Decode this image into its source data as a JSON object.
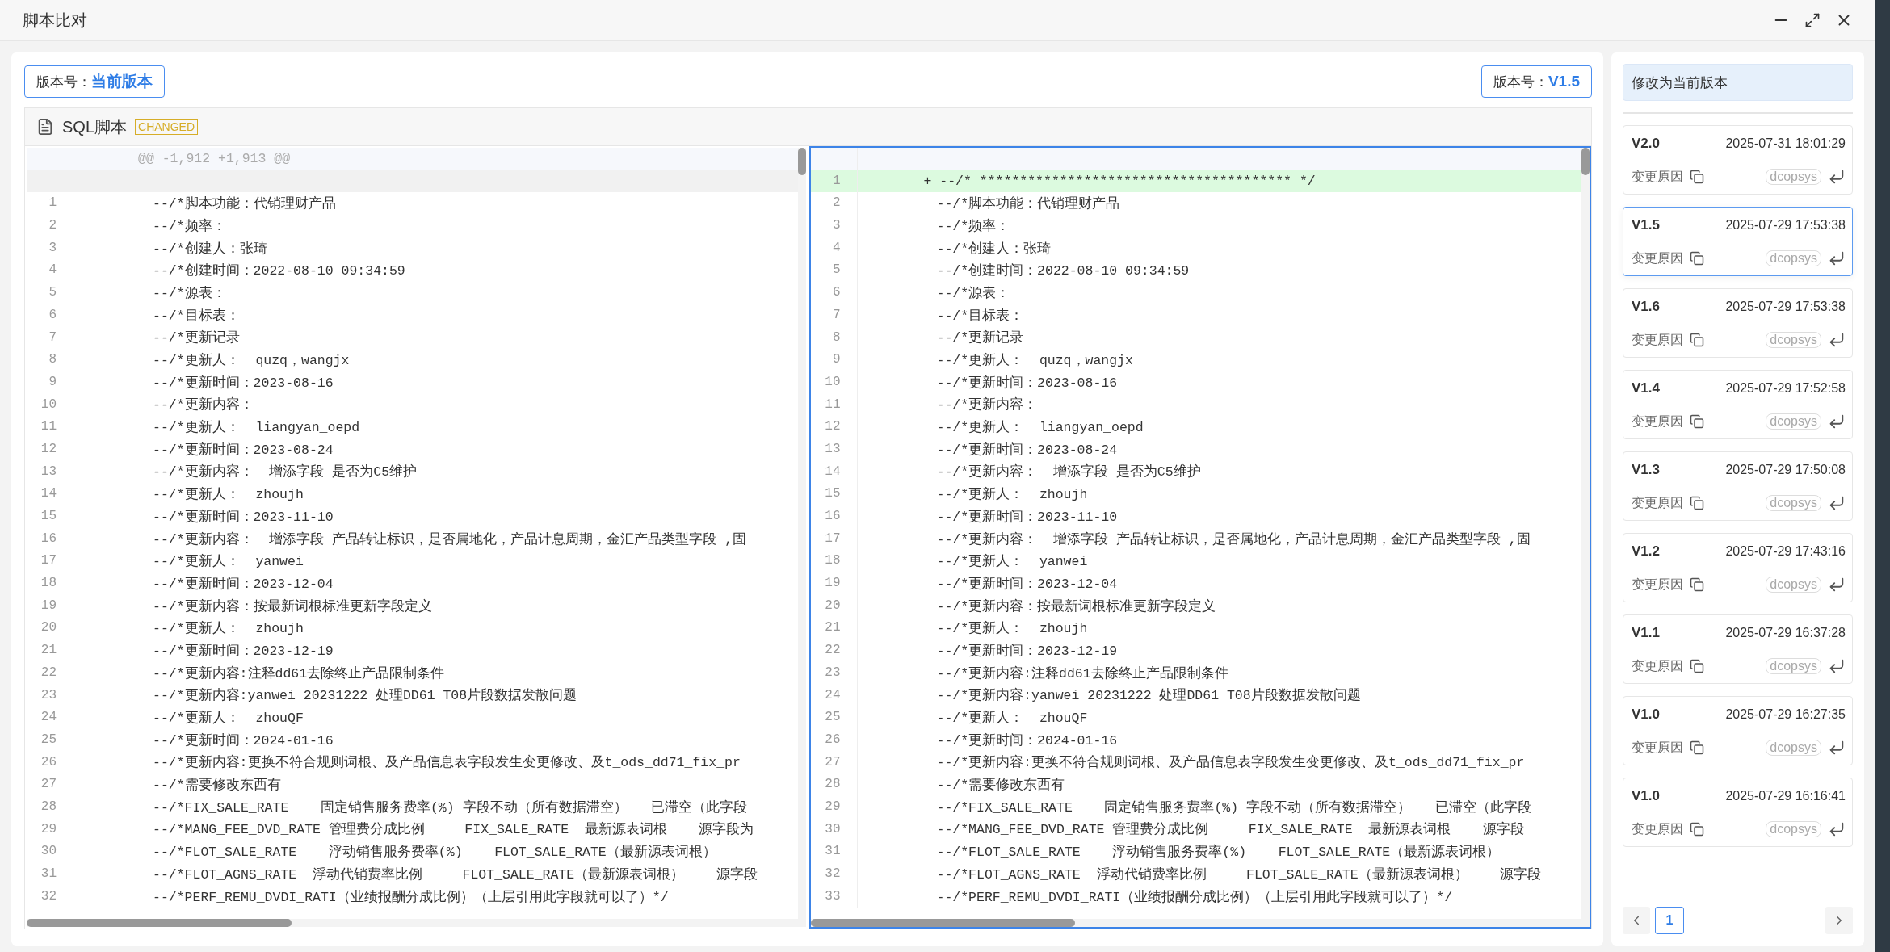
{
  "window": {
    "title": "脚本比对"
  },
  "left_version": {
    "label": "版本号：",
    "value": "当前版本"
  },
  "right_version": {
    "label": "版本号：",
    "value": "V1.5"
  },
  "file": {
    "name": "SQL脚本",
    "status": "CHANGED"
  },
  "left_pane": {
    "focused": false,
    "lines": [
      {
        "kind": "hunk",
        "text": "@@ -1,912 +1,913 @@"
      },
      {
        "kind": "blank"
      },
      {
        "kind": "context",
        "number": "1",
        "text": "--/*脚本功能：代销理财产品"
      },
      {
        "kind": "context",
        "number": "2",
        "text": "--/*频率："
      },
      {
        "kind": "context",
        "number": "3",
        "text": "--/*创建人：张琦"
      },
      {
        "kind": "context",
        "number": "4",
        "text": "--/*创建时间：2022-08-10 09:34:59"
      },
      {
        "kind": "context",
        "number": "5",
        "text": "--/*源表："
      },
      {
        "kind": "context",
        "number": "6",
        "text": "--/*目标表："
      },
      {
        "kind": "context",
        "number": "7",
        "text": "--/*更新记录"
      },
      {
        "kind": "context",
        "number": "8",
        "text": "--/*更新人：  quzq，wangjx"
      },
      {
        "kind": "context",
        "number": "9",
        "text": "--/*更新时间：2023-08-16"
      },
      {
        "kind": "context",
        "number": "10",
        "text": "--/*更新内容："
      },
      {
        "kind": "context",
        "number": "11",
        "text": "--/*更新人：  liangyan_oepd"
      },
      {
        "kind": "context",
        "number": "12",
        "text": "--/*更新时间：2023-08-24"
      },
      {
        "kind": "context",
        "number": "13",
        "text": "--/*更新内容：  增添字段 是否为C5维护"
      },
      {
        "kind": "context",
        "number": "14",
        "text": "--/*更新人：  zhoujh"
      },
      {
        "kind": "context",
        "number": "15",
        "text": "--/*更新时间：2023-11-10"
      },
      {
        "kind": "context",
        "number": "16",
        "text": "--/*更新内容：  增添字段 产品转让标识，是否属地化，产品计息周期，金汇产品类型字段 ,固"
      },
      {
        "kind": "context",
        "number": "17",
        "text": "--/*更新人：  yanwei"
      },
      {
        "kind": "context",
        "number": "18",
        "text": "--/*更新时间：2023-12-04"
      },
      {
        "kind": "context",
        "number": "19",
        "text": "--/*更新内容：按最新词根标准更新字段定义"
      },
      {
        "kind": "context",
        "number": "20",
        "text": "--/*更新人：  zhoujh"
      },
      {
        "kind": "context",
        "number": "21",
        "text": "--/*更新时间：2023-12-19"
      },
      {
        "kind": "context",
        "number": "22",
        "text": "--/*更新内容:注释dd61去除终止产品限制条件"
      },
      {
        "kind": "context",
        "number": "23",
        "text": "--/*更新内容:yanwei 20231222 处理DD61 T08片段数据发散问题"
      },
      {
        "kind": "context",
        "number": "24",
        "text": "--/*更新人：  zhouQF"
      },
      {
        "kind": "context",
        "number": "25",
        "text": "--/*更新时间：2024-01-16"
      },
      {
        "kind": "context",
        "number": "26",
        "text": "--/*更新内容:更换不符合规则词根、及产品信息表字段发生变更修改、及t_ods_dd71_fix_pr"
      },
      {
        "kind": "context",
        "number": "27",
        "text": "--/*需要修改东西有"
      },
      {
        "kind": "context",
        "number": "28",
        "text": "--/*FIX_SALE_RATE    固定销售服务费率(%) 字段不动（所有数据滞空）   已滞空（此字段"
      },
      {
        "kind": "context",
        "number": "29",
        "text": "--/*MANG_FEE_DVD_RATE 管理费分成比例     FIX_SALE_RATE  最新源表词根    源字段为"
      },
      {
        "kind": "context",
        "number": "30",
        "text": "--/*FLOT_SALE_RATE    浮动销售服务费率(%)    FLOT_SALE_RATE（最新源表词根）"
      },
      {
        "kind": "context",
        "number": "31",
        "text": "--/*FLOT_AGNS_RATE  浮动代销费率比例     FLOT_SALE_RATE（最新源表词根）    源字段"
      },
      {
        "kind": "context",
        "number": "32",
        "text": "--/*PERF_REMU_DVDI_RATI（业绩报酬分成比例）（上层引用此字段就可以了）*/"
      }
    ]
  },
  "right_pane": {
    "focused": true,
    "lines": [
      {
        "kind": "blank"
      },
      {
        "kind": "added",
        "number": "1",
        "text": "+ --/* *************************************** */"
      },
      {
        "kind": "context",
        "number": "2",
        "text": "--/*脚本功能：代销理财产品"
      },
      {
        "kind": "context",
        "number": "3",
        "text": "--/*频率："
      },
      {
        "kind": "context",
        "number": "4",
        "text": "--/*创建人：张琦"
      },
      {
        "kind": "context",
        "number": "5",
        "text": "--/*创建时间：2022-08-10 09:34:59"
      },
      {
        "kind": "context",
        "number": "6",
        "text": "--/*源表："
      },
      {
        "kind": "context",
        "number": "7",
        "text": "--/*目标表："
      },
      {
        "kind": "context",
        "number": "8",
        "text": "--/*更新记录"
      },
      {
        "kind": "context",
        "number": "9",
        "text": "--/*更新人：  quzq，wangjx"
      },
      {
        "kind": "context",
        "number": "10",
        "text": "--/*更新时间：2023-08-16"
      },
      {
        "kind": "context",
        "number": "11",
        "text": "--/*更新内容："
      },
      {
        "kind": "context",
        "number": "12",
        "text": "--/*更新人：  liangyan_oepd"
      },
      {
        "kind": "context",
        "number": "13",
        "text": "--/*更新时间：2023-08-24"
      },
      {
        "kind": "context",
        "number": "14",
        "text": "--/*更新内容：  增添字段 是否为C5维护"
      },
      {
        "kind": "context",
        "number": "15",
        "text": "--/*更新人：  zhoujh"
      },
      {
        "kind": "context",
        "number": "16",
        "text": "--/*更新时间：2023-11-10"
      },
      {
        "kind": "context",
        "number": "17",
        "text": "--/*更新内容：  增添字段 产品转让标识，是否属地化，产品计息周期，金汇产品类型字段 ,固"
      },
      {
        "kind": "context",
        "number": "18",
        "text": "--/*更新人：  yanwei"
      },
      {
        "kind": "context",
        "number": "19",
        "text": "--/*更新时间：2023-12-04"
      },
      {
        "kind": "context",
        "number": "20",
        "text": "--/*更新内容：按最新词根标准更新字段定义"
      },
      {
        "kind": "context",
        "number": "21",
        "text": "--/*更新人：  zhoujh"
      },
      {
        "kind": "context",
        "number": "22",
        "text": "--/*更新时间：2023-12-19"
      },
      {
        "kind": "context",
        "number": "23",
        "text": "--/*更新内容:注释dd61去除终止产品限制条件"
      },
      {
        "kind": "context",
        "number": "24",
        "text": "--/*更新内容:yanwei 20231222 处理DD61 T08片段数据发散问题"
      },
      {
        "kind": "context",
        "number": "25",
        "text": "--/*更新人：  zhouQF"
      },
      {
        "kind": "context",
        "number": "26",
        "text": "--/*更新时间：2024-01-16"
      },
      {
        "kind": "context",
        "number": "27",
        "text": "--/*更新内容:更换不符合规则词根、及产品信息表字段发生变更修改、及t_ods_dd71_fix_pr"
      },
      {
        "kind": "context",
        "number": "28",
        "text": "--/*需要修改东西有"
      },
      {
        "kind": "context",
        "number": "29",
        "text": "--/*FIX_SALE_RATE    固定销售服务费率(%) 字段不动（所有数据滞空）   已滞空（此字段"
      },
      {
        "kind": "context",
        "number": "30",
        "text": "--/*MANG_FEE_DVD_RATE 管理费分成比例     FIX_SALE_RATE  最新源表词根    源字段"
      },
      {
        "kind": "context",
        "number": "31",
        "text": "--/*FLOT_SALE_RATE    浮动销售服务费率(%)    FLOT_SALE_RATE（最新源表词根）"
      },
      {
        "kind": "context",
        "number": "32",
        "text": "--/*FLOT_AGNS_RATE  浮动代销费率比例     FLOT_SALE_RATE（最新源表词根）    源字段"
      },
      {
        "kind": "context",
        "number": "33",
        "text": "--/*PERF_REMU_DVDI_RATI（业绩报酬分成比例）（上层引用此字段就可以了）*/"
      }
    ]
  },
  "sidebar": {
    "action": "修改为当前版本",
    "versions": [
      {
        "version": "V2.0",
        "time": "2025-07-31 18:01:29",
        "reason": "变更原因",
        "user": "dcopsys",
        "selected": false
      },
      {
        "version": "V1.5",
        "time": "2025-07-29 17:53:38",
        "reason": "变更原因",
        "user": "dcopsys",
        "selected": true
      },
      {
        "version": "V1.6",
        "time": "2025-07-29 17:53:38",
        "reason": "变更原因",
        "user": "dcopsys",
        "selected": false
      },
      {
        "version": "V1.4",
        "time": "2025-07-29 17:52:58",
        "reason": "变更原因",
        "user": "dcopsys",
        "selected": false
      },
      {
        "version": "V1.3",
        "time": "2025-07-29 17:50:08",
        "reason": "变更原因",
        "user": "dcopsys",
        "selected": false
      },
      {
        "version": "V1.2",
        "time": "2025-07-29 17:43:16",
        "reason": "变更原因",
        "user": "dcopsys",
        "selected": false
      },
      {
        "version": "V1.1",
        "time": "2025-07-29 16:37:28",
        "reason": "变更原因",
        "user": "dcopsys",
        "selected": false
      },
      {
        "version": "V1.0",
        "time": "2025-07-29 16:27:35",
        "reason": "变更原因",
        "user": "dcopsys",
        "selected": false
      },
      {
        "version": "V1.0",
        "time": "2025-07-29 16:16:41",
        "reason": "变更原因",
        "user": "dcopsys",
        "selected": false
      }
    ],
    "pages": [
      {
        "label": "1",
        "selected": true
      }
    ]
  }
}
